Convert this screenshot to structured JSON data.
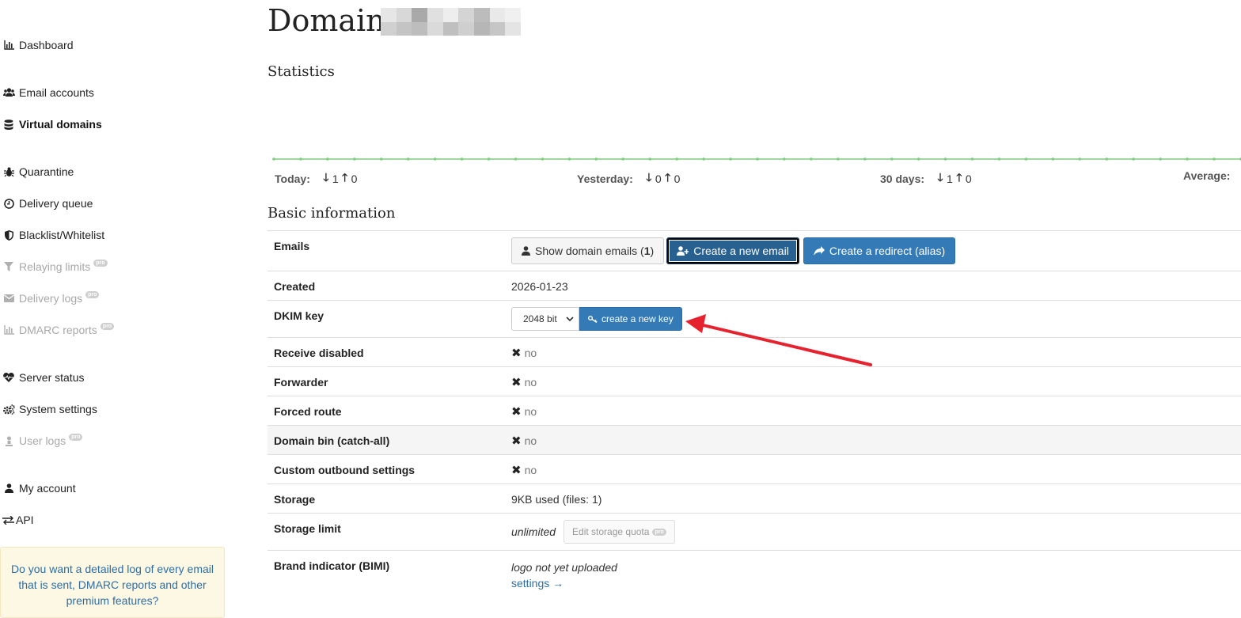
{
  "sidebar": {
    "items": [
      {
        "label": "Dashboard",
        "icon": "bar-chart-icon",
        "state": "normal"
      },
      {
        "label": "Email accounts",
        "icon": "users-icon",
        "state": "normal"
      },
      {
        "label": "Virtual domains",
        "icon": "database-icon",
        "state": "active"
      },
      {
        "label": "Quarantine",
        "icon": "bug-icon",
        "state": "normal"
      },
      {
        "label": "Delivery queue",
        "icon": "clock-icon",
        "state": "normal"
      },
      {
        "label": "Blacklist/Whitelist",
        "icon": "shield-icon",
        "state": "normal"
      },
      {
        "label": "Relaying limits",
        "icon": "filter-icon",
        "state": "disabled",
        "badge": "pro"
      },
      {
        "label": "Delivery logs",
        "icon": "envelope-icon",
        "state": "disabled",
        "badge": "pro"
      },
      {
        "label": "DMARC reports",
        "icon": "bar-chart-icon",
        "state": "disabled",
        "badge": "pro"
      },
      {
        "label": "Server status",
        "icon": "heartbeat-icon",
        "state": "normal"
      },
      {
        "label": "System settings",
        "icon": "gears-icon",
        "state": "normal"
      },
      {
        "label": "User logs",
        "icon": "user-log-icon",
        "state": "disabled",
        "badge": "pro"
      },
      {
        "label": "My account",
        "icon": "user-icon",
        "state": "normal"
      },
      {
        "label": "API",
        "icon": "exchange-icon",
        "state": "normal"
      }
    ],
    "promo_text": "Do you want a detailed log of every email that is sent, DMARC reports and other premium features?"
  },
  "page": {
    "title": "Domain",
    "statistics_heading": "Statistics",
    "basic_info_heading": "Basic information"
  },
  "stats": {
    "today": {
      "label": "Today:",
      "down": "1",
      "up": "0"
    },
    "yesterday": {
      "label": "Yesterday:",
      "down": "0",
      "up": "0"
    },
    "days30": {
      "label": "30 days:",
      "down": "1",
      "up": "0"
    },
    "average": {
      "label": "Average:"
    }
  },
  "chart_data": {
    "type": "line",
    "points": 37,
    "values": [
      0,
      0,
      0,
      0,
      0,
      0,
      0,
      0,
      0,
      0,
      0,
      0,
      0,
      0,
      0,
      0,
      0,
      0,
      0,
      0,
      0,
      0,
      0,
      0,
      0,
      0,
      0,
      0,
      0,
      0,
      0,
      0,
      0,
      0,
      0,
      0,
      0
    ],
    "color": "#7fce7f"
  },
  "info": {
    "emails": {
      "key": "Emails",
      "show_label": "Show domain emails",
      "show_count": "1",
      "create_email_label": "Create a new email",
      "create_redirect_label": "Create a redirect (alias)"
    },
    "created": {
      "key": "Created",
      "value": "2026-01-23"
    },
    "dkim": {
      "key": "DKIM key",
      "selected": "2048 bit",
      "button": "create a new key"
    },
    "receive_disabled": {
      "key": "Receive disabled",
      "value": "no"
    },
    "forwarder": {
      "key": "Forwarder",
      "value": "no"
    },
    "forced_route": {
      "key": "Forced route",
      "value": "no"
    },
    "domain_bin": {
      "key": "Domain bin (catch-all)",
      "value": "no"
    },
    "custom_outbound": {
      "key": "Custom outbound settings",
      "value": "no"
    },
    "storage": {
      "key": "Storage",
      "value": "9KB used (files: 1)"
    },
    "storage_limit": {
      "key": "Storage limit",
      "value": "unlimited",
      "button": "Edit storage quota",
      "badge": "pro"
    },
    "bimi": {
      "key": "Brand indicator (BIMI)",
      "value": "logo not yet uploaded",
      "link": "settings →"
    }
  },
  "colors": {
    "primary": "#337ab7",
    "annotation_arrow": "#e5222e",
    "chart_line": "#7fce7f",
    "promo_bg": "#fcf8e3"
  }
}
